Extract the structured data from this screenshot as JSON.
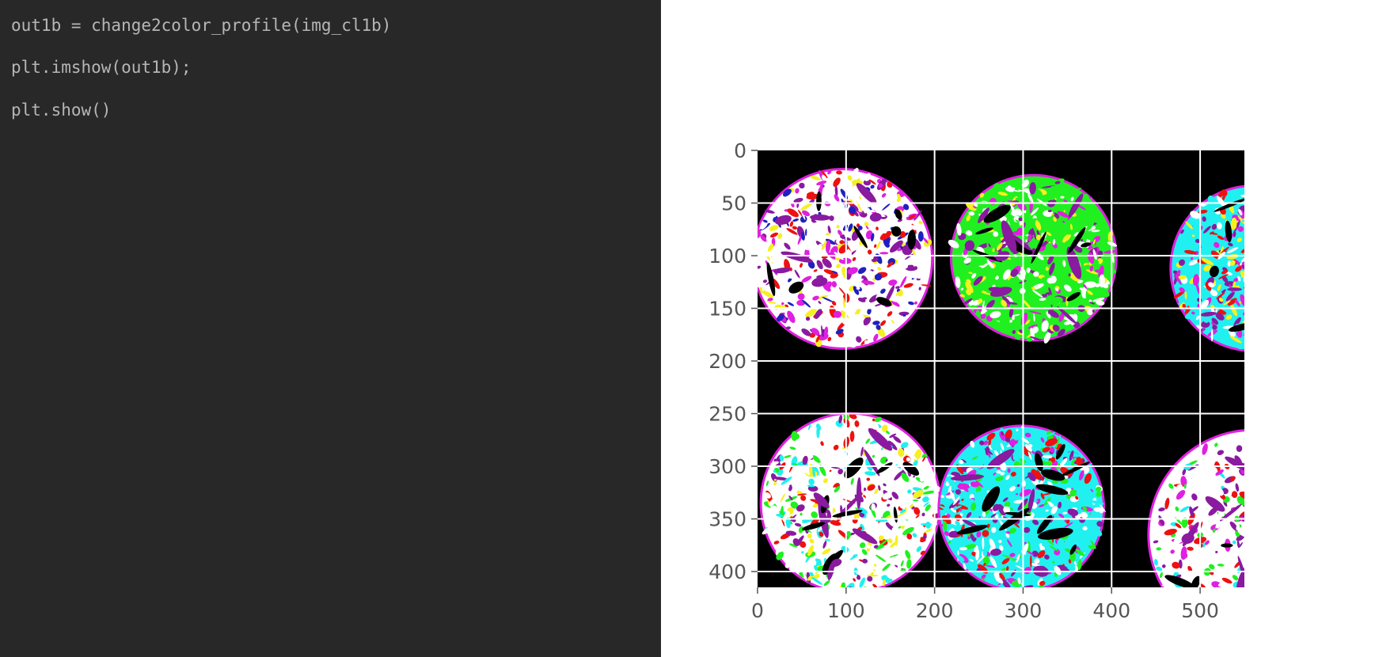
{
  "code_cell": {
    "lines": [
      "out1b = change2color_profile(img_cl1b)",
      "plt.imshow(out1b);",
      "plt.show()"
    ]
  },
  "chart_data": {
    "type": "image",
    "description_source": "matplotlib imshow output of out1b",
    "x_ticks": [
      "0",
      "100",
      "200",
      "300",
      "400",
      "500"
    ],
    "y_ticks": [
      "0",
      "50",
      "100",
      "150",
      "200",
      "250",
      "300",
      "350",
      "400"
    ],
    "xlim": [
      0,
      550
    ],
    "ylim": [
      415,
      0
    ],
    "grid": true,
    "colors": {
      "background": "#000000",
      "tissue_white": "#ffffff",
      "magenta": "#e020e0",
      "purple": "#8a1aa0",
      "cyan": "#20f0f0",
      "green": "#20f020",
      "red": "#ee1111",
      "yellow": "#f5f020",
      "blue": "#2020c0"
    },
    "tissue_cores": [
      {
        "cx": 96,
        "cy": 103,
        "r": 100,
        "dominant": "white/red/magenta"
      },
      {
        "cx": 312,
        "cy": 102,
        "r": 92,
        "dominant": "green/purple/white"
      },
      {
        "cx": 560,
        "cy": 112,
        "r": 92,
        "dominant": "cyan/yellow/purple"
      },
      {
        "cx": 105,
        "cy": 335,
        "r": 100,
        "dominant": "white/cyan/purple"
      },
      {
        "cx": 298,
        "cy": 340,
        "r": 92,
        "dominant": "cyan/white/purple"
      },
      {
        "cx": 560,
        "cy": 365,
        "r": 117,
        "dominant": "white/red/green"
      }
    ]
  }
}
